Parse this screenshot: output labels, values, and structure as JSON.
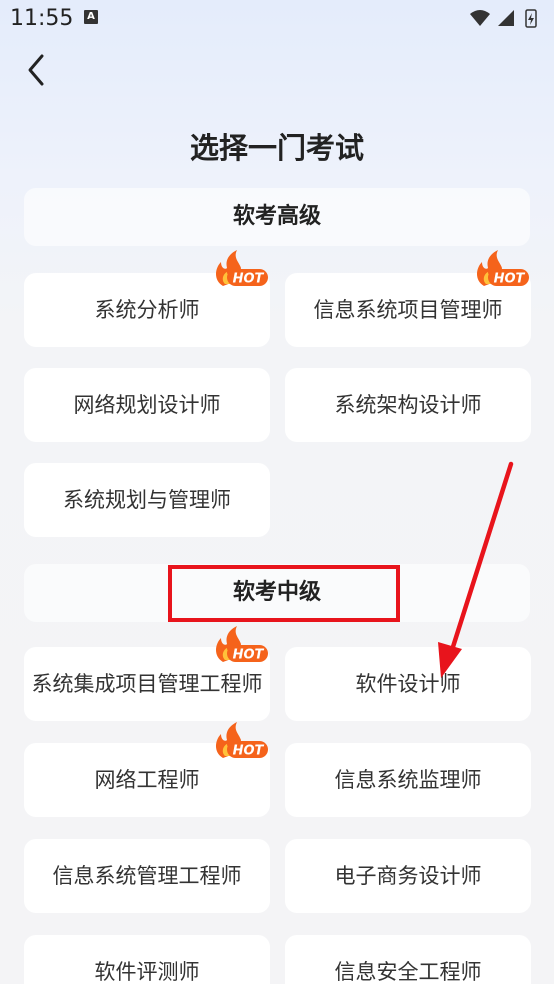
{
  "status_bar": {
    "time": "11:55",
    "notification_icon_letter": "A"
  },
  "header": {
    "title": "选择一门考试"
  },
  "sections": [
    {
      "title": "软考高级",
      "items": [
        {
          "label": "系统分析师",
          "hot": true
        },
        {
          "label": "信息系统项目管理师",
          "hot": true
        },
        {
          "label": "网络规划设计师",
          "hot": false
        },
        {
          "label": "系统架构设计师",
          "hot": false
        },
        {
          "label": "系统规划与管理师",
          "hot": false
        }
      ]
    },
    {
      "title": "软考中级",
      "items": [
        {
          "label": "系统集成项目管理工程师",
          "hot": true
        },
        {
          "label": "软件设计师",
          "hot": false
        },
        {
          "label": "网络工程师",
          "hot": true
        },
        {
          "label": "信息系统监理师",
          "hot": false
        },
        {
          "label": "信息系统管理工程师",
          "hot": false
        },
        {
          "label": "电子商务设计师",
          "hot": false
        },
        {
          "label": "软件评测师",
          "hot": false
        },
        {
          "label": "信息安全工程师",
          "hot": false
        }
      ]
    }
  ],
  "badge_text": "HOT",
  "colors": {
    "hot_orange": "#f5631b",
    "annotation_red": "#e8141c"
  }
}
